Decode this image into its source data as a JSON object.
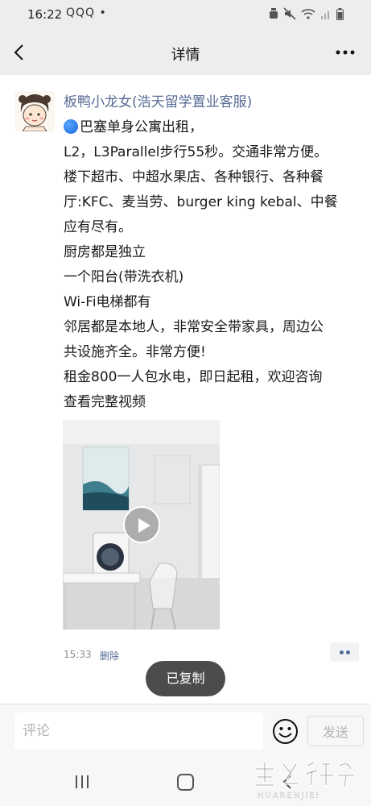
{
  "status_bar": {
    "time": "16:22",
    "notifications": "QQQ •"
  },
  "nav": {
    "title": "详情"
  },
  "post": {
    "author": "板鸭小龙女(浩天留学置业客服)",
    "lines": [
      "巴塞单身公寓出租，",
      "L2，L3Parallel步行55秒。交通非常方便。",
      "楼下超市、中超水果店、各种银行、各种餐",
      "厅:KFC、麦当劳、burger king kebal、中餐",
      "应有尽有。",
      "厨房都是独立",
      "一个阳台(带洗衣机)",
      "Wi-Fi电梯都有",
      "邻居都是本地人，非常安全带家具，周边公",
      "共设施齐全。非常方便!",
      "租金800一人包水电，即日起租，欢迎咨询",
      "查看完整视频"
    ],
    "time": "15:33",
    "delete_label": "删除"
  },
  "toast": {
    "text": "已复制"
  },
  "comment_bar": {
    "placeholder": "评论",
    "value": "",
    "send_label": "发送"
  },
  "icons": {
    "back": "back-arrow-icon",
    "more": "more-dots-icon",
    "emoji": "smiley-icon",
    "play": "play-icon",
    "bullet": "blue-dot-icon"
  },
  "colors": {
    "link": "#576b95",
    "background": "#ededed",
    "toast": "#4c4c4c"
  }
}
